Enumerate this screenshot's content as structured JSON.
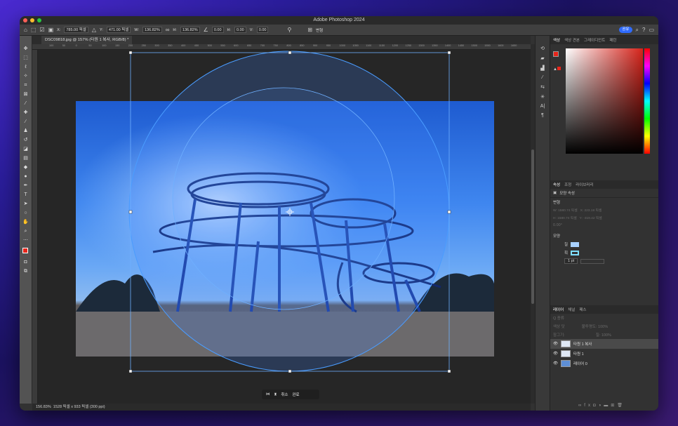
{
  "window": {
    "title": "Adobe Photoshop 2024"
  },
  "options_bar": {
    "x_label": "X:",
    "x_value": "785.00 픽셀",
    "y_label": "Y:",
    "y_value": "471.00 픽셀",
    "w_label": "W:",
    "w_value": "136.82%",
    "h_label": "H:",
    "h_value": "136.82%",
    "angle_value": "0.00",
    "h_skew_label": "H:",
    "h_skew_value": "0.00",
    "v_skew_label": "V:",
    "v_skew_value": "0.00",
    "warp_label": "변형",
    "share_label": "공유"
  },
  "document": {
    "tab_title": "DSC09818.jpg @ 157% (타원 1 복사, RGB/8) *"
  },
  "ruler": {
    "ticks": [
      "100",
      "50",
      "0",
      "50",
      "100",
      "150",
      "200",
      "250",
      "300",
      "350",
      "400",
      "450",
      "500",
      "550",
      "600",
      "650",
      "700",
      "750",
      "800",
      "850",
      "900",
      "950",
      "1000",
      "1050",
      "1100",
      "1150",
      "1200",
      "1250",
      "1300",
      "1350",
      "1400",
      "1450",
      "1500",
      "1550",
      "1600",
      "1650"
    ]
  },
  "status": {
    "zoom": "156.83%",
    "info": "1528 픽셀 x 933 픽셀 (300 ppi)"
  },
  "context_bar": {
    "cancel_label": "취소",
    "done_label": "완료"
  },
  "color_panel": {
    "tabs": [
      "색상",
      "색상 견본",
      "그레이디언트",
      "패턴"
    ],
    "active_tab": "색상",
    "foreground": "#e8251a",
    "background": "#000000"
  },
  "properties_panel": {
    "tabs": [
      "속성",
      "조정",
      "라이브러리"
    ],
    "active_tab": "속성",
    "shape_title": "모양 속성",
    "transform_heading": "변형",
    "w_field": "W: 1580.74 픽셀",
    "x_field": "X: 223.18 픽셀",
    "h_field": "H: 1580.74 픽셀",
    "y_field": "Y: -319.42 픽셀",
    "angle_field": "0.00°",
    "appearance_heading": "모양",
    "fill_label": "칠",
    "fill_color": "#a8d0ff",
    "stroke_label": "획",
    "stroke_color": "#7fe0ff",
    "stroke_width": "1 pt"
  },
  "layers_panel": {
    "tabs": [
      "레이어",
      "채널",
      "패스"
    ],
    "active_tab": "레이어",
    "search_label": "Q 종류",
    "blend_mode": "색상 닷",
    "opacity_label": "불투명도: 100%",
    "lock_label": "잠그기:",
    "fill_label": "칠: 100%",
    "layers": [
      {
        "name": "타원 1 복사",
        "selected": true
      },
      {
        "name": "타원 1",
        "selected": false
      },
      {
        "name": "레이어 0",
        "selected": false
      }
    ]
  }
}
